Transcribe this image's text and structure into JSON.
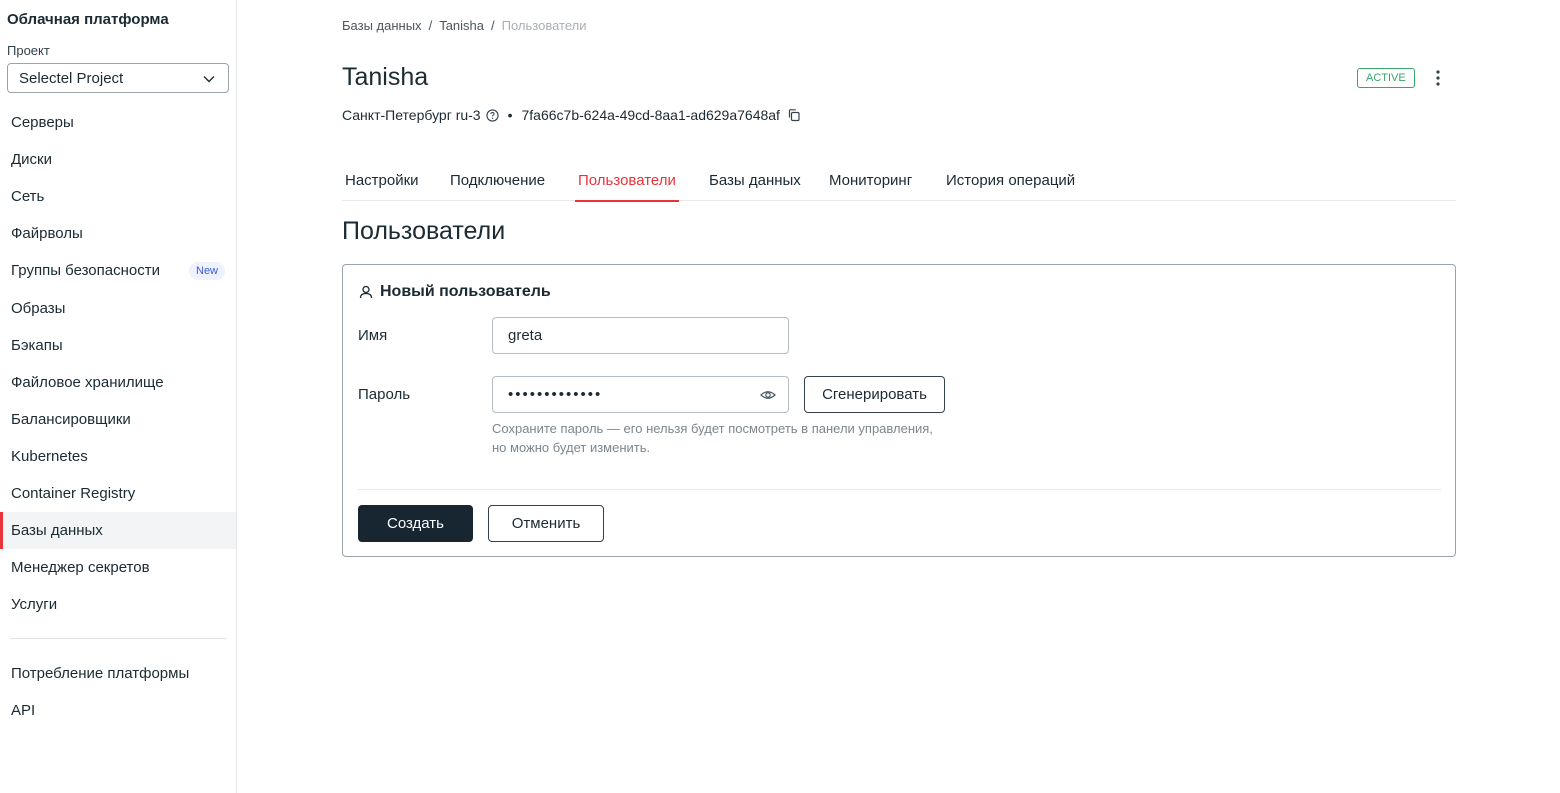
{
  "sidebar": {
    "platform_title": "Облачная платформа",
    "project_label": "Проект",
    "project_value": "Selectel Project",
    "items": [
      {
        "label": "Серверы"
      },
      {
        "label": "Диски"
      },
      {
        "label": "Сеть"
      },
      {
        "label": "Файрволы"
      },
      {
        "label": "Группы безопасности",
        "badge": "New"
      },
      {
        "label": "Образы"
      },
      {
        "label": "Бэкапы"
      },
      {
        "label": "Файловое хранилище"
      },
      {
        "label": "Балансировщики"
      },
      {
        "label": "Kubernetes"
      },
      {
        "label": "Container Registry"
      },
      {
        "label": "Базы данных",
        "active": true
      },
      {
        "label": "Менеджер секретов"
      },
      {
        "label": "Услуги"
      }
    ],
    "bottom_items": [
      {
        "label": "Потребление платформы"
      },
      {
        "label": "API"
      }
    ]
  },
  "breadcrumb": {
    "items": [
      "Базы данных",
      "Tanisha"
    ],
    "current": "Пользователи",
    "separator": "/"
  },
  "header": {
    "title": "Tanisha",
    "status": "ACTIVE",
    "region": "Санкт-Петербург ru-3",
    "id": "7fa66c7b-624a-49cd-8aa1-ad629a7648af"
  },
  "tabs": [
    {
      "label": "Настройки"
    },
    {
      "label": "Подключение"
    },
    {
      "label": "Пользователи",
      "active": true
    },
    {
      "label": "Базы данных"
    },
    {
      "label": "Мониторинг"
    },
    {
      "label": "История операций"
    }
  ],
  "section_title": "Пользователи",
  "form": {
    "header": "Новый пользователь",
    "name_label": "Имя",
    "name_value": "greta",
    "password_label": "Пароль",
    "password_value": "•••••••••••••",
    "generate_label": "Сгенерировать",
    "hint_line1": "Сохраните пароль — его нельзя будет посмотреть в панели управления,",
    "hint_line2": "но можно будет изменить.",
    "create_label": "Создать",
    "cancel_label": "Отменить"
  },
  "colors": {
    "accent": "#e8333a",
    "status_active": "#3aa46a",
    "primary_button": "#172630"
  }
}
